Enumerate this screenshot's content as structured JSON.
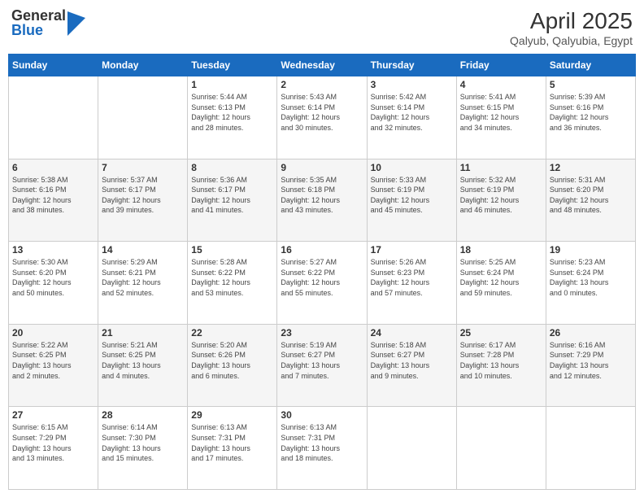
{
  "header": {
    "logo_general": "General",
    "logo_blue": "Blue",
    "title": "April 2025",
    "subtitle": "Qalyub, Qalyubia, Egypt"
  },
  "calendar": {
    "days_of_week": [
      "Sunday",
      "Monday",
      "Tuesday",
      "Wednesday",
      "Thursday",
      "Friday",
      "Saturday"
    ],
    "weeks": [
      [
        {
          "day": "",
          "info": ""
        },
        {
          "day": "",
          "info": ""
        },
        {
          "day": "1",
          "info": "Sunrise: 5:44 AM\nSunset: 6:13 PM\nDaylight: 12 hours\nand 28 minutes."
        },
        {
          "day": "2",
          "info": "Sunrise: 5:43 AM\nSunset: 6:14 PM\nDaylight: 12 hours\nand 30 minutes."
        },
        {
          "day": "3",
          "info": "Sunrise: 5:42 AM\nSunset: 6:14 PM\nDaylight: 12 hours\nand 32 minutes."
        },
        {
          "day": "4",
          "info": "Sunrise: 5:41 AM\nSunset: 6:15 PM\nDaylight: 12 hours\nand 34 minutes."
        },
        {
          "day": "5",
          "info": "Sunrise: 5:39 AM\nSunset: 6:16 PM\nDaylight: 12 hours\nand 36 minutes."
        }
      ],
      [
        {
          "day": "6",
          "info": "Sunrise: 5:38 AM\nSunset: 6:16 PM\nDaylight: 12 hours\nand 38 minutes."
        },
        {
          "day": "7",
          "info": "Sunrise: 5:37 AM\nSunset: 6:17 PM\nDaylight: 12 hours\nand 39 minutes."
        },
        {
          "day": "8",
          "info": "Sunrise: 5:36 AM\nSunset: 6:17 PM\nDaylight: 12 hours\nand 41 minutes."
        },
        {
          "day": "9",
          "info": "Sunrise: 5:35 AM\nSunset: 6:18 PM\nDaylight: 12 hours\nand 43 minutes."
        },
        {
          "day": "10",
          "info": "Sunrise: 5:33 AM\nSunset: 6:19 PM\nDaylight: 12 hours\nand 45 minutes."
        },
        {
          "day": "11",
          "info": "Sunrise: 5:32 AM\nSunset: 6:19 PM\nDaylight: 12 hours\nand 46 minutes."
        },
        {
          "day": "12",
          "info": "Sunrise: 5:31 AM\nSunset: 6:20 PM\nDaylight: 12 hours\nand 48 minutes."
        }
      ],
      [
        {
          "day": "13",
          "info": "Sunrise: 5:30 AM\nSunset: 6:20 PM\nDaylight: 12 hours\nand 50 minutes."
        },
        {
          "day": "14",
          "info": "Sunrise: 5:29 AM\nSunset: 6:21 PM\nDaylight: 12 hours\nand 52 minutes."
        },
        {
          "day": "15",
          "info": "Sunrise: 5:28 AM\nSunset: 6:22 PM\nDaylight: 12 hours\nand 53 minutes."
        },
        {
          "day": "16",
          "info": "Sunrise: 5:27 AM\nSunset: 6:22 PM\nDaylight: 12 hours\nand 55 minutes."
        },
        {
          "day": "17",
          "info": "Sunrise: 5:26 AM\nSunset: 6:23 PM\nDaylight: 12 hours\nand 57 minutes."
        },
        {
          "day": "18",
          "info": "Sunrise: 5:25 AM\nSunset: 6:24 PM\nDaylight: 12 hours\nand 59 minutes."
        },
        {
          "day": "19",
          "info": "Sunrise: 5:23 AM\nSunset: 6:24 PM\nDaylight: 13 hours\nand 0 minutes."
        }
      ],
      [
        {
          "day": "20",
          "info": "Sunrise: 5:22 AM\nSunset: 6:25 PM\nDaylight: 13 hours\nand 2 minutes."
        },
        {
          "day": "21",
          "info": "Sunrise: 5:21 AM\nSunset: 6:25 PM\nDaylight: 13 hours\nand 4 minutes."
        },
        {
          "day": "22",
          "info": "Sunrise: 5:20 AM\nSunset: 6:26 PM\nDaylight: 13 hours\nand 6 minutes."
        },
        {
          "day": "23",
          "info": "Sunrise: 5:19 AM\nSunset: 6:27 PM\nDaylight: 13 hours\nand 7 minutes."
        },
        {
          "day": "24",
          "info": "Sunrise: 5:18 AM\nSunset: 6:27 PM\nDaylight: 13 hours\nand 9 minutes."
        },
        {
          "day": "25",
          "info": "Sunrise: 6:17 AM\nSunset: 7:28 PM\nDaylight: 13 hours\nand 10 minutes."
        },
        {
          "day": "26",
          "info": "Sunrise: 6:16 AM\nSunset: 7:29 PM\nDaylight: 13 hours\nand 12 minutes."
        }
      ],
      [
        {
          "day": "27",
          "info": "Sunrise: 6:15 AM\nSunset: 7:29 PM\nDaylight: 13 hours\nand 13 minutes."
        },
        {
          "day": "28",
          "info": "Sunrise: 6:14 AM\nSunset: 7:30 PM\nDaylight: 13 hours\nand 15 minutes."
        },
        {
          "day": "29",
          "info": "Sunrise: 6:13 AM\nSunset: 7:31 PM\nDaylight: 13 hours\nand 17 minutes."
        },
        {
          "day": "30",
          "info": "Sunrise: 6:13 AM\nSunset: 7:31 PM\nDaylight: 13 hours\nand 18 minutes."
        },
        {
          "day": "",
          "info": ""
        },
        {
          "day": "",
          "info": ""
        },
        {
          "day": "",
          "info": ""
        }
      ]
    ]
  }
}
